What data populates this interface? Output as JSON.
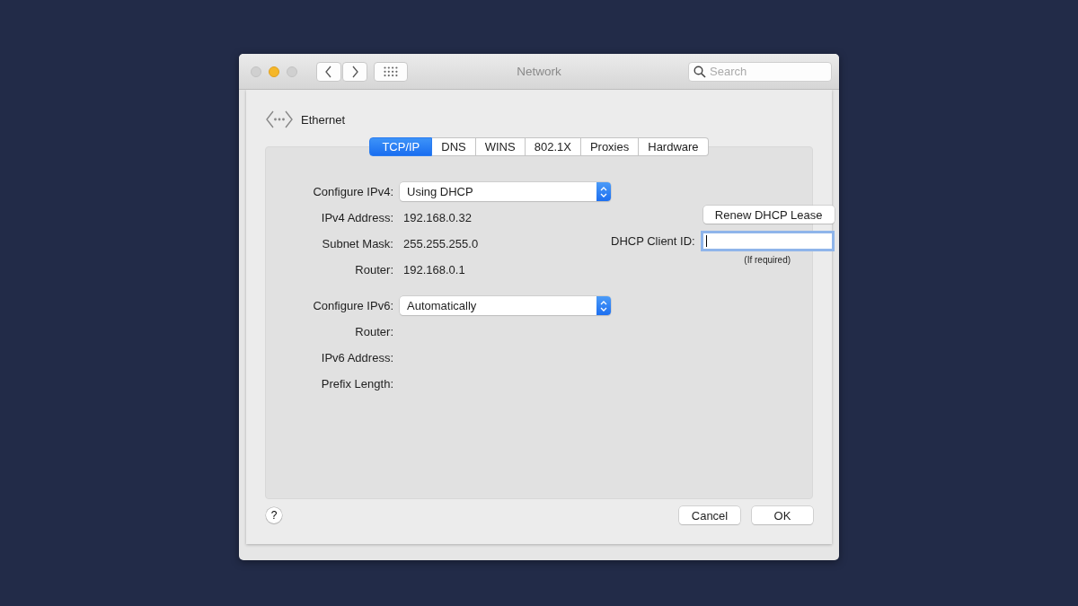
{
  "window": {
    "title": "Network"
  },
  "search": {
    "placeholder": "Search"
  },
  "interface": {
    "name": "Ethernet"
  },
  "tabs": [
    {
      "label": "TCP/IP",
      "selected": true
    },
    {
      "label": "DNS",
      "selected": false
    },
    {
      "label": "WINS",
      "selected": false
    },
    {
      "label": "802.1X",
      "selected": false
    },
    {
      "label": "Proxies",
      "selected": false
    },
    {
      "label": "Hardware",
      "selected": false
    }
  ],
  "ipv4": [
    {
      "kind": "popup",
      "label": "Configure IPv4:",
      "value": "Using DHCP"
    },
    {
      "kind": "text",
      "label": "IPv4 Address:",
      "value": "192.168.0.32"
    },
    {
      "kind": "text",
      "label": "Subnet Mask:",
      "value": "255.255.255.0"
    },
    {
      "kind": "text",
      "label": "Router:",
      "value": "192.168.0.1"
    }
  ],
  "ipv6": [
    {
      "kind": "popup",
      "label": "Configure IPv6:",
      "value": "Automatically"
    },
    {
      "kind": "text",
      "label": "Router:"
    },
    {
      "kind": "text",
      "label": "IPv6 Address:"
    },
    {
      "kind": "text",
      "label": "Prefix Length:"
    }
  ],
  "dhcp": {
    "renew_button": "Renew DHCP Lease",
    "client_id_label": "DHCP Client ID:",
    "client_id_hint": "(If required)"
  },
  "help": "?",
  "buttons": [
    "Cancel",
    "OK"
  ]
}
